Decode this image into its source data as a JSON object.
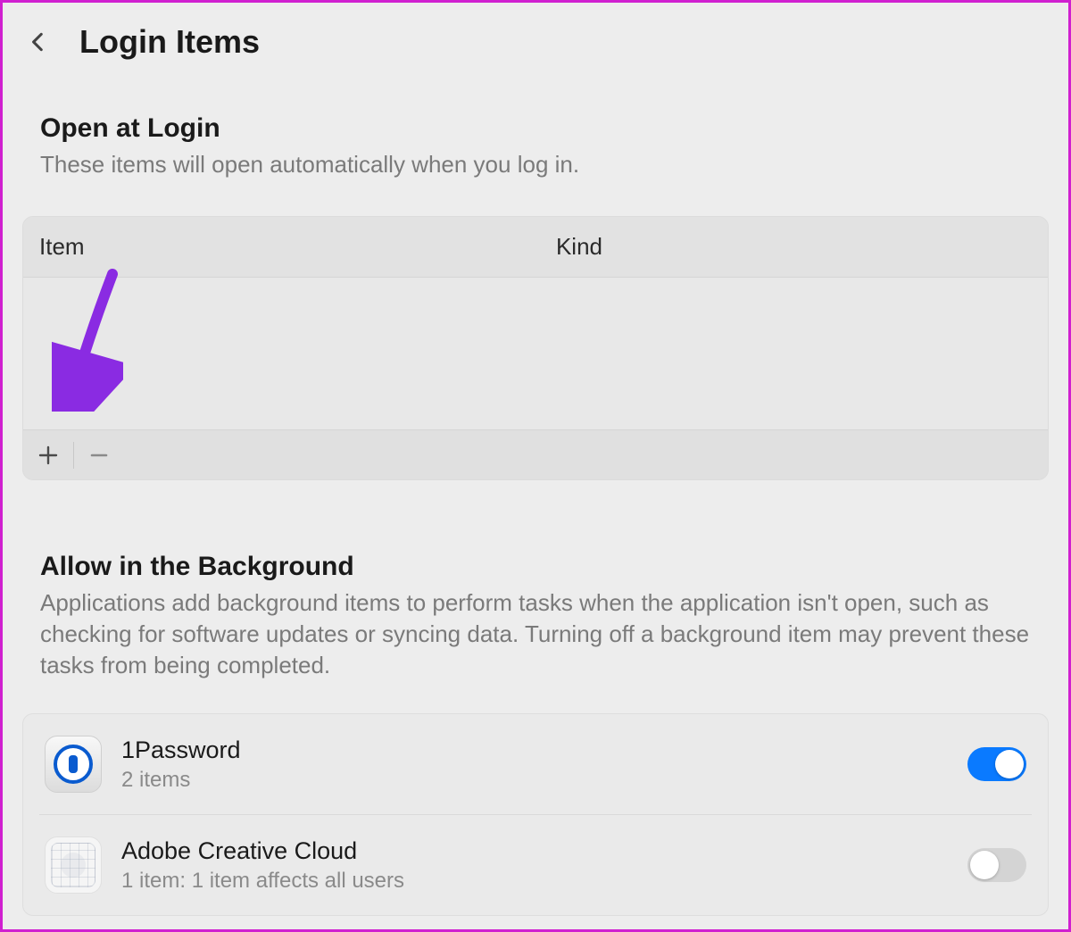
{
  "header": {
    "title": "Login Items"
  },
  "open_at_login": {
    "title": "Open at Login",
    "desc": "These items will open automatically when you log in.",
    "columns": {
      "item": "Item",
      "kind": "Kind"
    }
  },
  "background": {
    "title": "Allow in the Background",
    "desc": "Applications add background items to perform tasks when the application isn't open, such as checking for software updates or syncing data. Turning off a background item may prevent these tasks from being completed.",
    "apps": [
      {
        "name": "1Password",
        "sub": "2 items",
        "icon": "onepassword",
        "enabled": true
      },
      {
        "name": "Adobe Creative Cloud",
        "sub": "1 item: 1 item affects all users",
        "icon": "adobe",
        "enabled": false
      }
    ]
  }
}
